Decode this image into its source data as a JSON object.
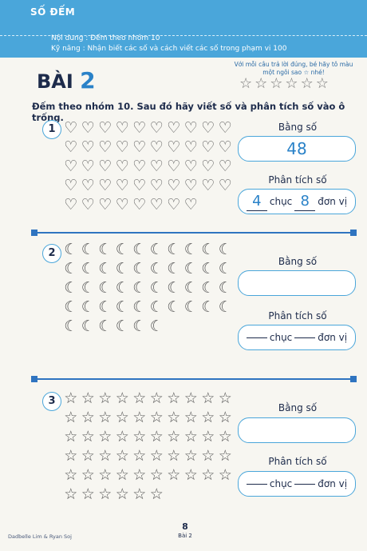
{
  "header": {
    "topic": "SỐ ĐẾM",
    "content_line": "Nội dung : Đếm theo nhóm 10",
    "skill_line": "Kỹ năng : Nhận biết các số và cách viết các số trong phạm vi 100"
  },
  "lesson": {
    "title_word": "BÀI",
    "title_number": "2"
  },
  "rating": {
    "note": "Với mỗi câu trả lời đúng, bé hãy tô màu một ngôi sao ☆ nhé!",
    "stars": [
      "☆",
      "☆",
      "☆",
      "☆",
      "☆",
      "☆"
    ]
  },
  "instruction": "Đếm theo nhóm 10. Sau đó hãy viết số và phân tích số vào ô trống.",
  "labels": {
    "number": "Bằng số",
    "analysis": "Phân tích số",
    "tens": "chục",
    "units": "đơn vị"
  },
  "problems": [
    {
      "badge": "1",
      "icon": "heart-icon",
      "symbol": "♡",
      "count": 48,
      "number": "48",
      "tens": "4",
      "units": "8"
    },
    {
      "badge": "2",
      "icon": "moon-icon",
      "symbol": "☾",
      "count": 46,
      "number": "",
      "tens": "",
      "units": ""
    },
    {
      "badge": "3",
      "icon": "star-icon",
      "symbol": "☆",
      "count": 56,
      "number": "",
      "tens": "",
      "units": ""
    }
  ],
  "footer": {
    "authors": "Dadbelle Lim & Ryan Soj",
    "page_number": "8",
    "page_label": "Bài 2"
  }
}
